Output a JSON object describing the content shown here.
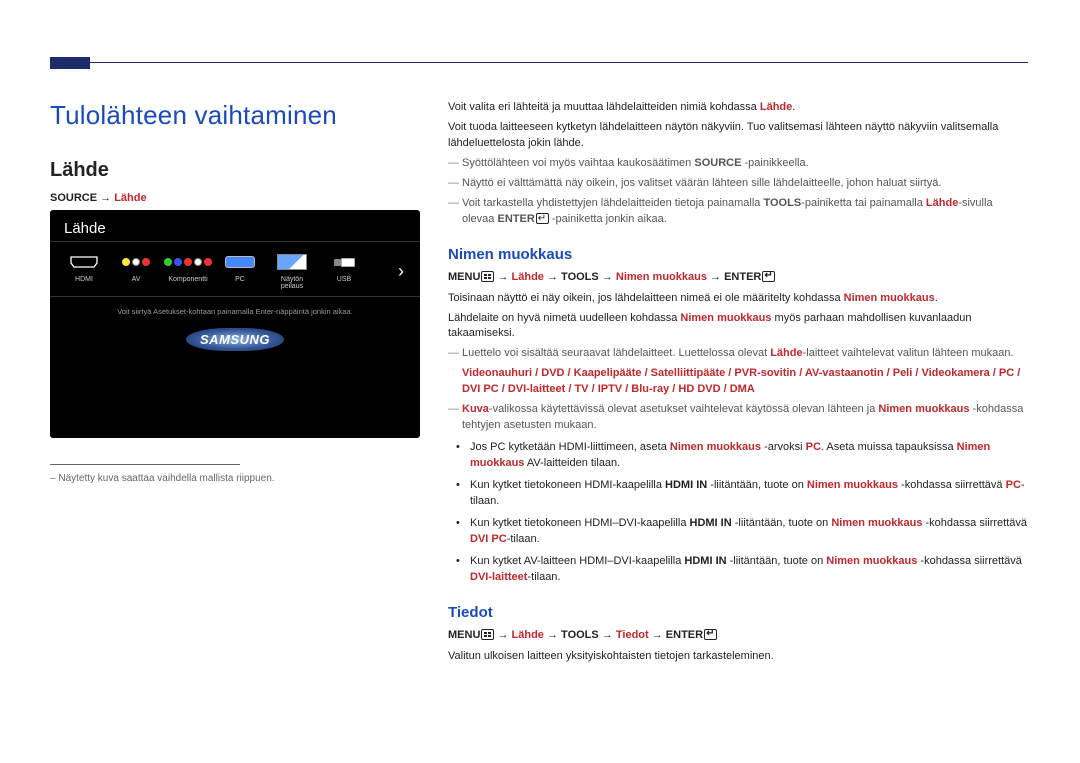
{
  "header": {
    "title": "Tulolähteen vaihtaminen",
    "section": "Lähde"
  },
  "path1": {
    "source": "SOURCE",
    "arrow": " → ",
    "lahde": "Lähde"
  },
  "screenshot": {
    "title": "Lähde",
    "items": [
      {
        "label": "HDMI",
        "type": "hdmi"
      },
      {
        "label": "AV",
        "type": "av"
      },
      {
        "label": "Komponentti",
        "type": "component"
      },
      {
        "label": "PC",
        "type": "pc"
      },
      {
        "label": "Näytön peilaus",
        "type": "mirror"
      },
      {
        "label": "USB",
        "type": "usb"
      }
    ],
    "hint": "Voit siirtyä Asetukset-kohtaan painamalla Enter-näppäintä jonkin aikaa.",
    "logo": "SAMSUNG"
  },
  "footnote": "Näytetty kuva saattaa vaihdella mallista riippuen.",
  "intro": {
    "p1a": "Voit valita eri lähteitä ja muuttaa lähdelaitteiden nimiä kohdassa ",
    "p1b": "Lähde",
    "p1c": ".",
    "p2": "Voit tuoda laitteeseen kytketyn lähdelaitteen näytön näkyviin. Tuo valitsemasi lähteen näyttö näkyviin valitsemalla lähdeluettelosta jokin lähde.",
    "d1a": "Syöttölähteen voi myös vaihtaa kaukosäätimen ",
    "d1b": "SOURCE",
    "d1c": " -painikkeella.",
    "d2": "Näyttö ei välttämättä näy oikein, jos valitset väärän lähteen sille lähdelaitteelle, johon haluat siirtyä.",
    "d3a": "Voit tarkastella yhdistettyjen lähdelaitteiden tietoja painamalla ",
    "d3b": "TOOLS",
    "d3c": "-painiketta tai painamalla ",
    "d3d": "Lähde",
    "d3e": "-sivulla olevaa ",
    "d3f": "ENTER",
    "d3g": " -painiketta jonkin aikaa."
  },
  "nimen": {
    "title": "Nimen muokkaus",
    "menu": "MENU",
    "arrow": " → ",
    "lahde": "Lähde",
    "tools": "TOOLS",
    "target": "Nimen muokkaus",
    "enter": "ENTER",
    "p1a": "Toisinaan näyttö ei näy oikein, jos lähdelaitteen nimeä ei ole määritelty kohdassa ",
    "p1b": "Nimen muokkaus",
    "p1c": ".",
    "p2a": "Lähdelaite on hyvä nimetä uudelleen kohdassa ",
    "p2b": "Nimen muokkaus",
    "p2c": " myös parhaan mahdollisen kuvanlaadun takaamiseksi.",
    "d1a": "Luettelo voi sisältää seuraavat lähdelaitteet. Luettelossa olevat ",
    "d1b": "Lähde",
    "d1c": "-laitteet vaihtelevat valitun lähteen mukaan.",
    "devices": "Videonauhuri / DVD / Kaapelipääte / Satelliittipääte / PVR-sovitin / AV-vastaanotin / Peli / Videokamera / PC / DVI PC / DVI-laitteet / TV / IPTV / Blu-ray / HD DVD / DMA",
    "d2a": "Kuva",
    "d2b": "-valikossa käytettävissä olevat asetukset vaihtelevat käytössä olevan lähteen ja ",
    "d2c": "Nimen muokkaus",
    "d2d": " -kohdassa tehtyjen asetusten mukaan.",
    "b1a": "Jos PC kytketään HDMI-liittimeen, aseta ",
    "b1b": "Nimen muokkaus",
    "b1c": " -arvoksi ",
    "b1d": "PC",
    "b1e": ". Aseta muissa tapauksissa ",
    "b1f": "Nimen muokkaus",
    "b1g": " AV-laitteiden tilaan.",
    "b2a": "Kun kytket tietokoneen HDMI-kaapelilla ",
    "b2b": "HDMI IN",
    "b2c": " -liitäntään, tuote on ",
    "b2d": "Nimen muokkaus",
    "b2e": " -kohdassa siirrettävä ",
    "b2f": "PC",
    "b2g": "-tilaan.",
    "b3a": "Kun kytket tietokoneen HDMI–DVI-kaapelilla ",
    "b3b": "HDMI IN",
    "b3c": " -liitäntään, tuote on ",
    "b3d": "Nimen muokkaus",
    "b3e": " -kohdassa siirrettävä ",
    "b3f": "DVI PC",
    "b3g": "-tilaan.",
    "b4a": "Kun kytket AV-laitteen HDMI–DVI-kaapelilla ",
    "b4b": "HDMI IN",
    "b4c": " -liitäntään, tuote on ",
    "b4d": "Nimen muokkaus",
    "b4e": " -kohdassa siirrettävä ",
    "b4f": "DVI-laitteet",
    "b4g": "-tilaan."
  },
  "tiedot": {
    "title": "Tiedot",
    "menu": "MENU",
    "arrow": " → ",
    "lahde": "Lähde",
    "tools": "TOOLS",
    "target": "Tiedot",
    "enter": "ENTER",
    "p1": "Valitun ulkoisen laitteen yksityiskohtaisten tietojen tarkasteleminen."
  }
}
